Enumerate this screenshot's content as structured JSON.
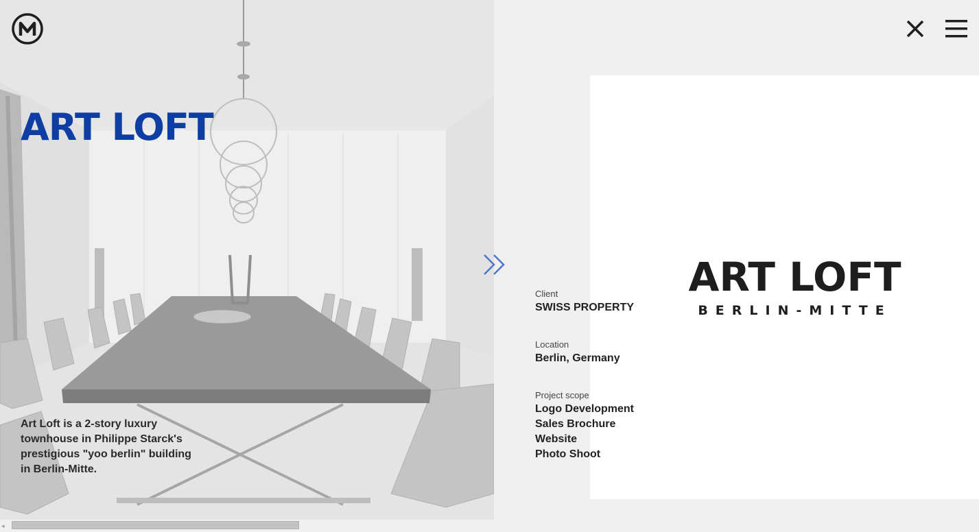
{
  "header": {
    "logo_icon": "m-circle-logo-icon",
    "close_icon": "close-icon",
    "menu_icon": "hamburger-menu-icon"
  },
  "hero": {
    "title": "ART LOFT",
    "title_color": "#0e3ea3",
    "description": "Art Loft is a 2-story luxury townhouse in Philippe Starck's prestigious \"yoo berlin\" building in Berlin-Mitte.",
    "next_icon": "double-chevron-right-icon",
    "accent_color": "#3a6fd0"
  },
  "details": [
    {
      "label": "Client",
      "values": [
        "SWISS PROPERTY"
      ]
    },
    {
      "label": "Location",
      "values": [
        "Berlin, Germany"
      ]
    },
    {
      "label": "Project scope",
      "values": [
        "Logo Development",
        "Sales Brochure",
        "Website",
        "Photo Shoot"
      ]
    }
  ],
  "logo_card": {
    "name": "ART LOFT",
    "subtitle": "BERLIN-MITTE"
  },
  "scrollbar": {
    "left_arrow": "◂"
  }
}
